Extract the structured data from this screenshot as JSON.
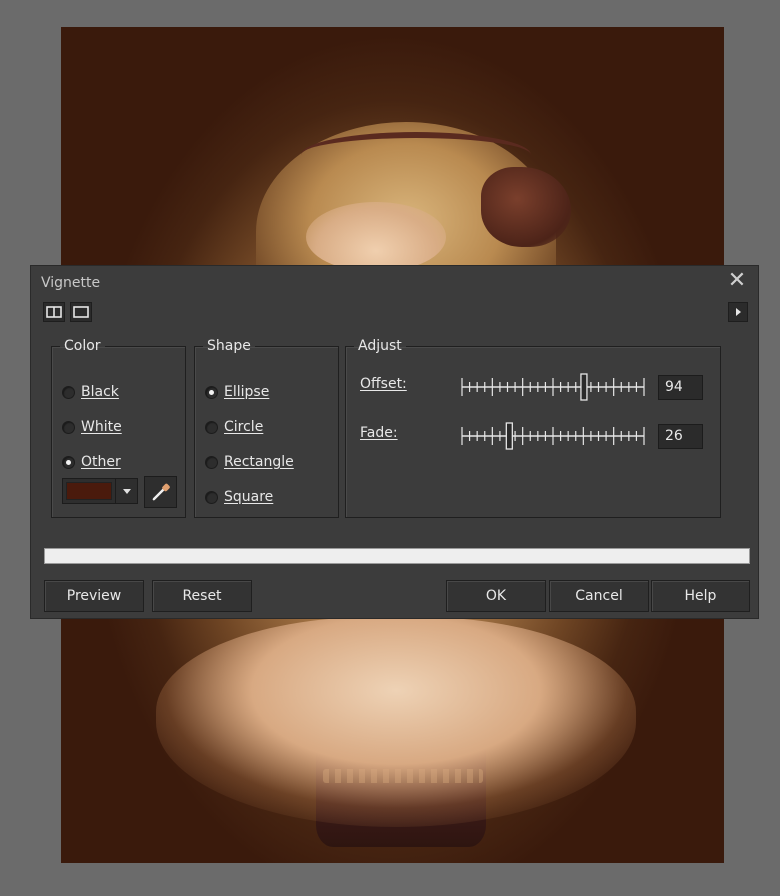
{
  "dialog": {
    "title": "Vignette",
    "close_symbol": "✕"
  },
  "color_group": {
    "legend": "Color",
    "options": [
      {
        "label": "Black",
        "selected": false
      },
      {
        "label": "White",
        "selected": false
      },
      {
        "label": "Other",
        "selected": true
      }
    ],
    "swatch_color": "#4a1a0c"
  },
  "shape_group": {
    "legend": "Shape",
    "options": [
      {
        "label": "Ellipse",
        "selected": true
      },
      {
        "label": "Circle",
        "selected": false
      },
      {
        "label": "Rectangle",
        "selected": false
      },
      {
        "label": "Square",
        "selected": false
      }
    ]
  },
  "adjust_group": {
    "legend": "Adjust",
    "offset": {
      "label": "Offset:",
      "value": "94",
      "fraction": 0.67
    },
    "fade": {
      "label": "Fade:",
      "value": "26",
      "fraction": 0.26
    }
  },
  "buttons": {
    "preview": "Preview",
    "reset": "Reset",
    "ok": "OK",
    "cancel": "Cancel",
    "help": "Help"
  },
  "icons": {
    "split_view": "split-view-icon",
    "single_view": "single-view-icon",
    "expand": "play-arrow-icon",
    "eyedropper": "eyedropper-icon"
  }
}
